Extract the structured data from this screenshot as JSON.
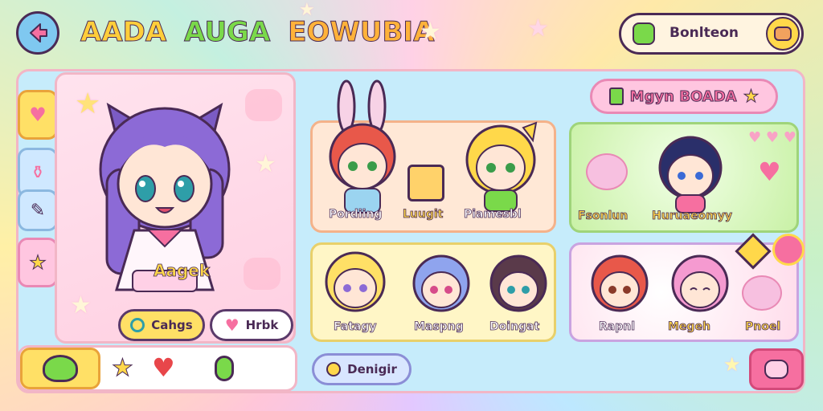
{
  "header": {
    "title_word1": "AADA",
    "title_word2": "AUGA",
    "title_word3": "EOWUBIA",
    "search_label": "Bonlteon"
  },
  "profile": {
    "name": "Aagek",
    "chat_button": "Cahgs",
    "heart_button": "Hrbk"
  },
  "section": {
    "title": "Mgyn BOADA"
  },
  "groups": [
    {
      "members": [
        "Pordiing",
        "Luugit",
        "Piamesbl"
      ]
    },
    {
      "members": [
        "Fsonlun",
        "Huruaeomyy"
      ]
    },
    {
      "members": [
        "Fatagy",
        "Maspng",
        "Doingat"
      ]
    },
    {
      "members": [
        "Rapnl",
        "Megeh",
        "Pnoel"
      ]
    }
  ],
  "footer": {
    "design_button": "Denigir"
  },
  "colors": {
    "accent_pink": "#f66fa0",
    "accent_yellow": "#ffd84a",
    "panel_blue": "#c6ecfb",
    "title_green": "#7ad94a"
  },
  "icons": [
    "back-arrow-icon",
    "cactus-icon",
    "cookie-icon",
    "heart-icon",
    "bottle-icon",
    "wand-icon",
    "star-icon",
    "search-icon",
    "slime-icon",
    "paw-icon"
  ]
}
